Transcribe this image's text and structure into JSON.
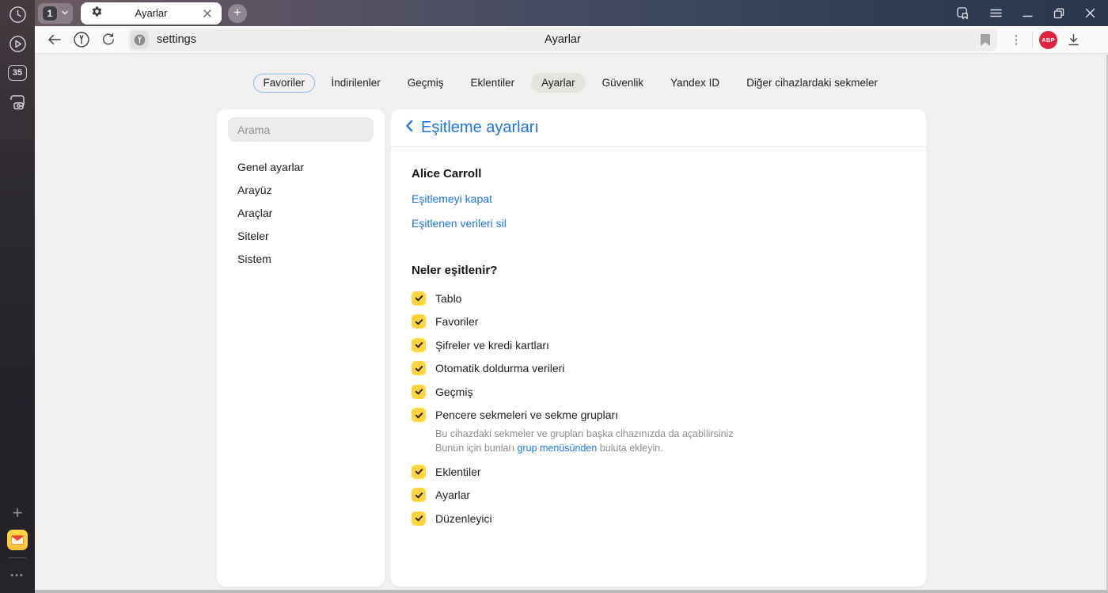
{
  "browser": {
    "tab_group_count": "1",
    "tab_title": "Ayarlar",
    "new_tab_glyph": "+",
    "url": "settings",
    "page_title": "Ayarlar",
    "abp_label": "ABP",
    "overflow_dots_glyph": "⋮"
  },
  "rail": {
    "counter": "35",
    "plus_glyph": "+",
    "dots_glyph": "•••"
  },
  "nav": {
    "tabs": [
      {
        "label": "Favoriler",
        "style": "outlined"
      },
      {
        "label": "İndirilenler"
      },
      {
        "label": "Geçmiş"
      },
      {
        "label": "Eklentiler"
      },
      {
        "label": "Ayarlar",
        "style": "active"
      },
      {
        "label": "Güvenlik"
      },
      {
        "label": "Yandex ID"
      },
      {
        "label": "Diğer cihazlardaki sekmeler"
      }
    ]
  },
  "settings_sidebar": {
    "search_placeholder": "Arama",
    "items": [
      {
        "label": "Genel ayarlar"
      },
      {
        "label": "Arayüz"
      },
      {
        "label": "Araçlar"
      },
      {
        "label": "Siteler"
      },
      {
        "label": "Sistem"
      }
    ]
  },
  "main": {
    "header_title": "Eşitleme ayarları",
    "account_name": "Alice Carroll",
    "link_disable_sync": "Eşitlemeyi kapat",
    "link_delete_synced": "Eşitlenen verileri sil",
    "section_heading": "Neler eşitlenir?",
    "sync_items": [
      {
        "label": "Tablo",
        "checked": true
      },
      {
        "label": "Favoriler",
        "checked": true
      },
      {
        "label": "Şifreler ve kredi kartları",
        "checked": true
      },
      {
        "label": "Otomatik doldurma verileri",
        "checked": true
      },
      {
        "label": "Geçmiş",
        "checked": true
      },
      {
        "label": "Pencere sekmeleri ve sekme grupları",
        "checked": true,
        "desc_line1": "Bu cihazdaki sekmeler ve grupları başka cihazınızda da açabilirsiniz",
        "desc_line2_pre": "Bunun için bunları ",
        "desc_link": "grup menüsünden",
        "desc_line2_post": " buluta ekleyin."
      },
      {
        "label": "Eklentiler",
        "checked": true
      },
      {
        "label": "Ayarlar",
        "checked": true
      },
      {
        "label": "Düzenleyici",
        "checked": true
      }
    ]
  },
  "colors": {
    "accent_blue": "#1b73e8",
    "checkbox_yellow": "#ffd43e",
    "abp_red": "#e0233f",
    "titlebar_gradient_left": "#6d5a61",
    "titlebar_gradient_right": "#2c364e",
    "page_background": "#f1f0ee"
  }
}
